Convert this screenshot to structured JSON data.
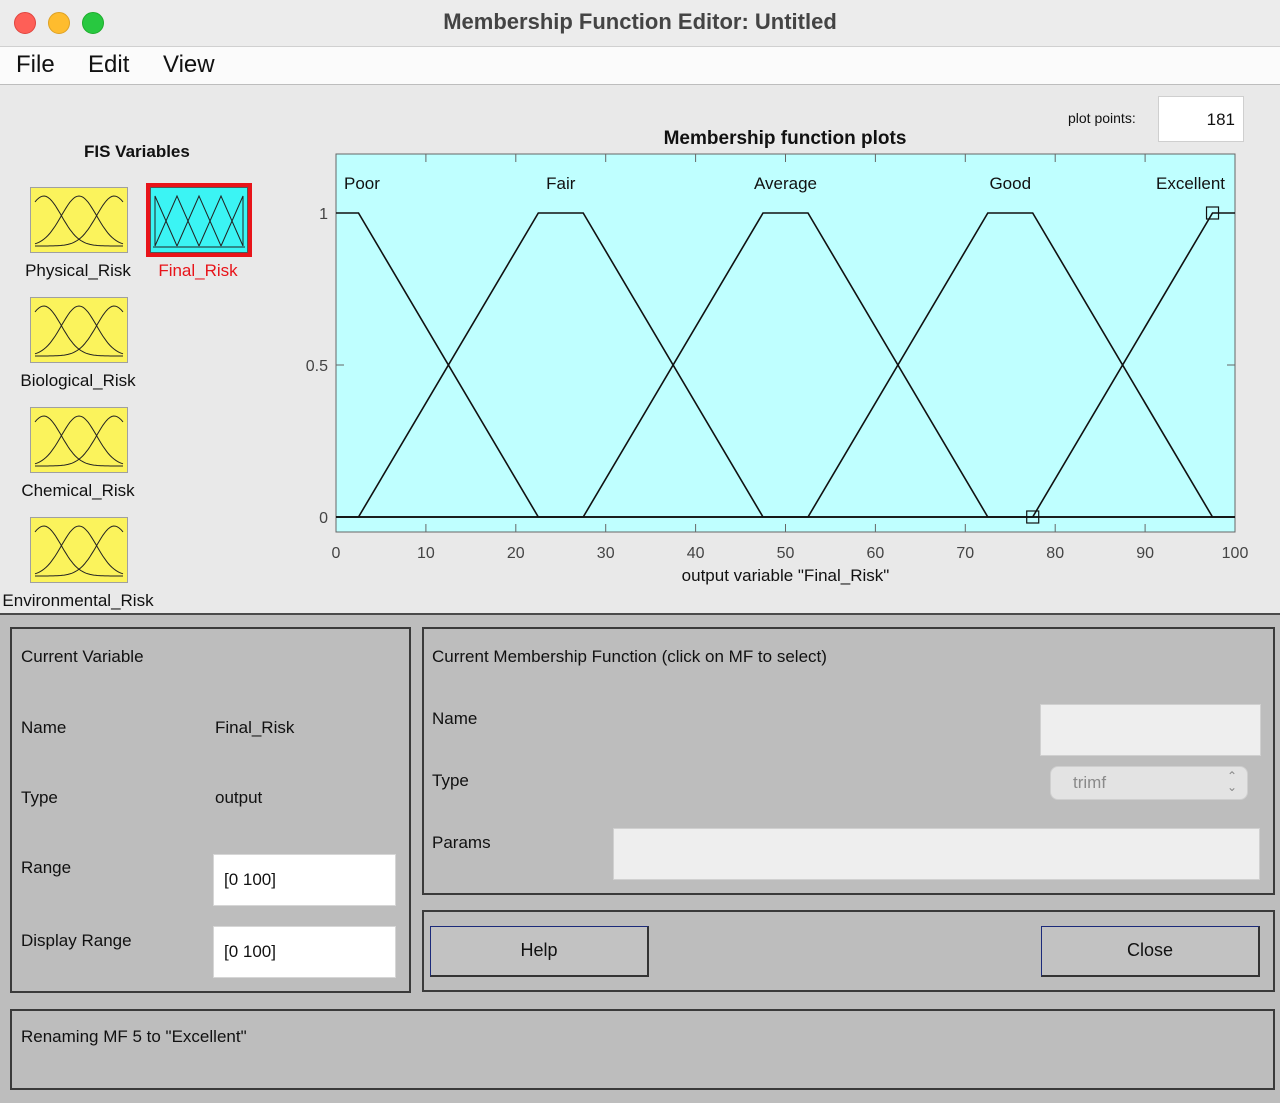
{
  "window": {
    "title": "Membership Function Editor: Untitled"
  },
  "menu": [
    "File",
    "Edit",
    "View"
  ],
  "fis_variables": {
    "title": "FIS Variables",
    "inputs": [
      {
        "label": "Physical_Risk"
      },
      {
        "label": "Biological_Risk"
      },
      {
        "label": "Chemical_Risk"
      },
      {
        "label": "Environmental_Risk"
      }
    ],
    "output": {
      "label": "Final_Risk",
      "selected": true
    }
  },
  "plot_points": {
    "label": "plot points:",
    "value": "181"
  },
  "chart_data": {
    "type": "line",
    "title": "Membership function plots",
    "xlabel": "output variable \"Final_Risk\"",
    "ylabel": "",
    "xlim": [
      0,
      100
    ],
    "ylim": [
      0,
      1
    ],
    "xticks": [
      0,
      10,
      20,
      30,
      40,
      50,
      60,
      70,
      80,
      90,
      100
    ],
    "yticks": [
      0,
      0.5,
      1
    ],
    "background": "#bfffff",
    "series": [
      {
        "name": "Poor",
        "x": [
          0,
          2.5,
          22.5,
          100
        ],
        "y": [
          1,
          1,
          0,
          0
        ]
      },
      {
        "name": "Fair",
        "x": [
          0,
          2.5,
          22.5,
          27.5,
          47.5,
          100
        ],
        "y": [
          0,
          0,
          1,
          1,
          0,
          0
        ]
      },
      {
        "name": "Average",
        "x": [
          0,
          27.5,
          47.5,
          52.5,
          72.5,
          100
        ],
        "y": [
          0,
          0,
          1,
          1,
          0,
          0
        ]
      },
      {
        "name": "Good",
        "x": [
          0,
          52.5,
          72.5,
          77.5,
          97.5,
          100
        ],
        "y": [
          0,
          0,
          1,
          1,
          0,
          0
        ]
      },
      {
        "name": "Excellent",
        "x": [
          0,
          77.5,
          97.5,
          100
        ],
        "y": [
          0,
          0,
          1,
          1
        ]
      }
    ],
    "selected_mf_markers": [
      {
        "x": 77.5,
        "y": 0
      },
      {
        "x": 97.5,
        "y": 1
      }
    ]
  },
  "current_variable": {
    "title": "Current Variable",
    "name_label": "Name",
    "name_value": "Final_Risk",
    "type_label": "Type",
    "type_value": "output",
    "range_label": "Range",
    "range_value": "[0 100]",
    "display_range_label": "Display Range",
    "display_range_value": "[0 100]"
  },
  "current_mf": {
    "title": "Current Membership Function (click on MF to select)",
    "name_label": "Name",
    "name_value": "",
    "type_label": "Type",
    "type_value": "trimf",
    "params_label": "Params",
    "params_value": ""
  },
  "buttons": {
    "help": "Help",
    "close": "Close"
  },
  "status": {
    "message": "Renaming MF 5 to \"Excellent\""
  },
  "colors": {
    "plot_bg": "#bfffff",
    "input_icon": "#fbf35c",
    "output_icon": "#3bf4f4",
    "selected": "#e8141a"
  }
}
